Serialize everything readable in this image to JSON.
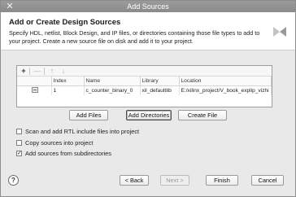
{
  "window": {
    "title": "Add Sources",
    "close_glyph": "✕"
  },
  "header": {
    "title": "Add or Create Design Sources",
    "description": "Specify HDL, netlist, Block Design, and IP files, or directories containing those file types to add to your project. Create a new source file on disk and add it to your project."
  },
  "toolbar": {
    "add_glyph": "+",
    "remove_glyph": "—",
    "up_glyph": "↑",
    "down_glyph": "↓"
  },
  "table": {
    "columns": [
      "",
      "Index",
      "Name",
      "Library",
      "Location"
    ],
    "rows": [
      {
        "icon": "file-icon",
        "index": "1",
        "name": "c_counter_binary_0",
        "library": "xil_defaultlib",
        "location": "E:/xilinx_project/V_book_explip_vizhi"
      }
    ]
  },
  "file_buttons": {
    "add_files": "Add Files",
    "add_directories": "Add Directories",
    "create_file": "Create File"
  },
  "options": [
    {
      "label": "Scan and add RTL include files into project",
      "checked": false
    },
    {
      "label": "Copy sources into project",
      "checked": false
    },
    {
      "label": "Add sources from subdirectories",
      "checked": true
    }
  ],
  "footer": {
    "help": "?",
    "back": "< Back",
    "next": "Next >",
    "finish": "Finish",
    "cancel": "Cancel"
  }
}
